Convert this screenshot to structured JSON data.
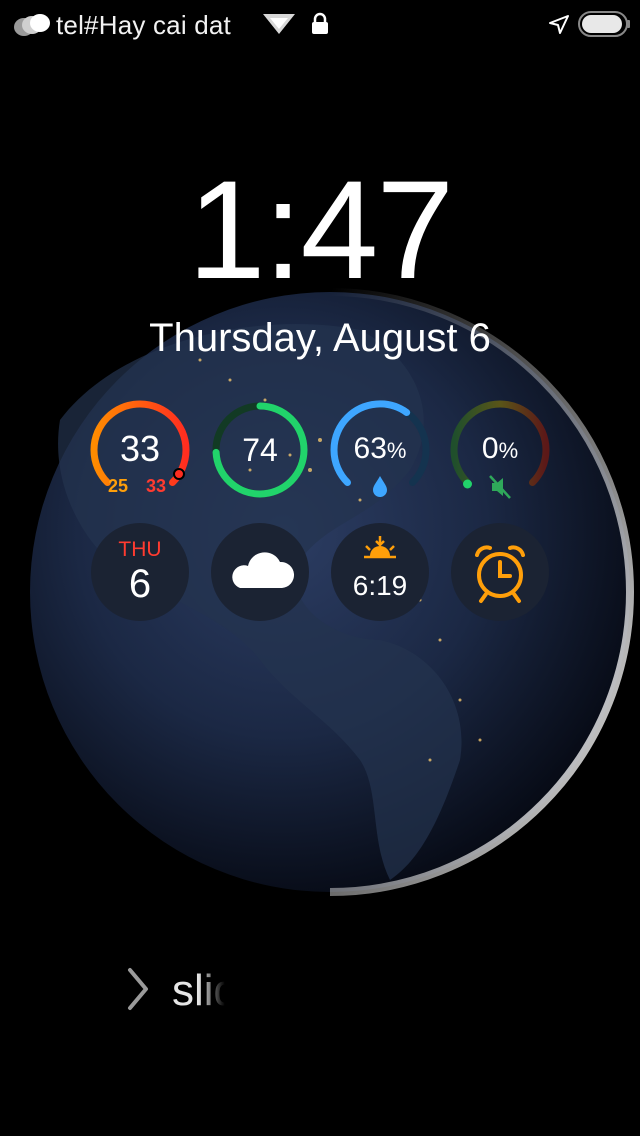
{
  "status_bar": {
    "carrier": "tel#Hay cai dat",
    "icons": [
      "carrier-signal-icon",
      "wifi-icon",
      "lock-icon",
      "location-icon",
      "battery-icon"
    ]
  },
  "lockscreen": {
    "time": "1:47",
    "date": "Thursday, August 6",
    "slide_text": "slid"
  },
  "widgets": {
    "temperature": {
      "value": "33",
      "low": "25",
      "high": "33",
      "colors": [
        "#ff8c00",
        "#ff2d20"
      ]
    },
    "health": {
      "value": "74",
      "progress": 0.74,
      "color": "#21d36b"
    },
    "humidity": {
      "value": "63",
      "unit": "%",
      "progress": 0.63,
      "color": "#3ea6ff"
    },
    "volume": {
      "value": "0",
      "unit": "%",
      "progress": 0.0,
      "icon": "mute-icon"
    },
    "calendar": {
      "weekday": "THU",
      "day": "6",
      "accent": "#ff3b30"
    },
    "weather": {
      "icon": "cloud-icon"
    },
    "sunrise": {
      "time": "6:19",
      "icon": "sunrise-icon",
      "accent": "#ff9f0a"
    },
    "alarm": {
      "icon": "alarm-clock-icon",
      "accent": "#ff9f0a"
    }
  }
}
